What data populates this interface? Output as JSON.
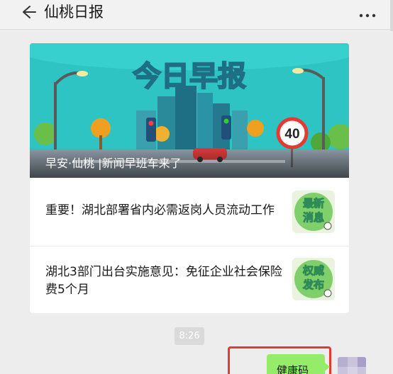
{
  "header": {
    "title": "仙桃日报",
    "back_icon": "arrow-left-icon",
    "more_icon": "more-dots-icon"
  },
  "article_card": {
    "cover": {
      "banner_title": "今日早报",
      "speed_sign": "40",
      "caption": "早安·仙桃 |新闻早班车来了"
    },
    "items": [
      {
        "text": "重要！湖北部署省内必需返岗人员流动工作",
        "thumb_label": "最新消息",
        "thumb_line1": "最新",
        "thumb_line2": "消息"
      },
      {
        "text": "湖北3部门出台实施意见：免征企业社会保险费5个月",
        "thumb_label": "权威发布",
        "thumb_line1": "权威",
        "thumb_line2": "发布"
      }
    ]
  },
  "timestamp": "8:26",
  "message": {
    "text": "健康码"
  },
  "colors": {
    "accent_bubble": "#95ec69",
    "highlight_border": "#e53935",
    "banner_bg": "#2ec4c4"
  }
}
